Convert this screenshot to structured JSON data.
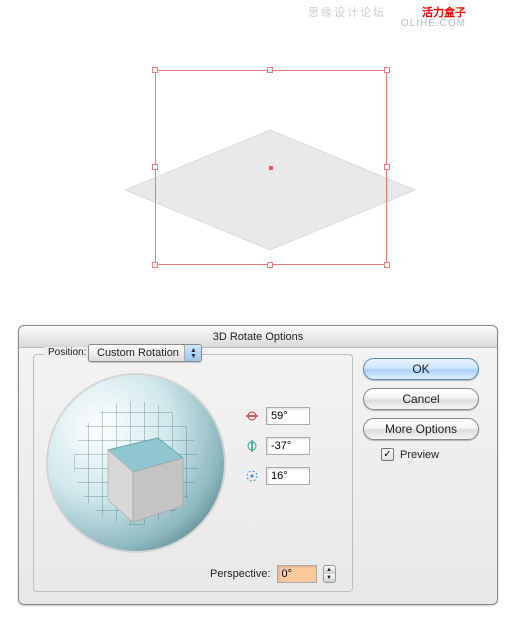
{
  "watermark": {
    "cn": "思缘设计论坛",
    "red": "活力盒子",
    "url": "OLIHE.COM"
  },
  "dialog": {
    "title": "3D Rotate Options",
    "position_label": "Position:",
    "position_value": "Custom Rotation",
    "axis": {
      "x": "59°",
      "y": "-37°",
      "z": "16°"
    },
    "perspective_label": "Perspective:",
    "perspective_value": "0°",
    "buttons": {
      "ok": "OK",
      "cancel": "Cancel",
      "more": "More Options"
    },
    "preview_label": "Preview"
  }
}
